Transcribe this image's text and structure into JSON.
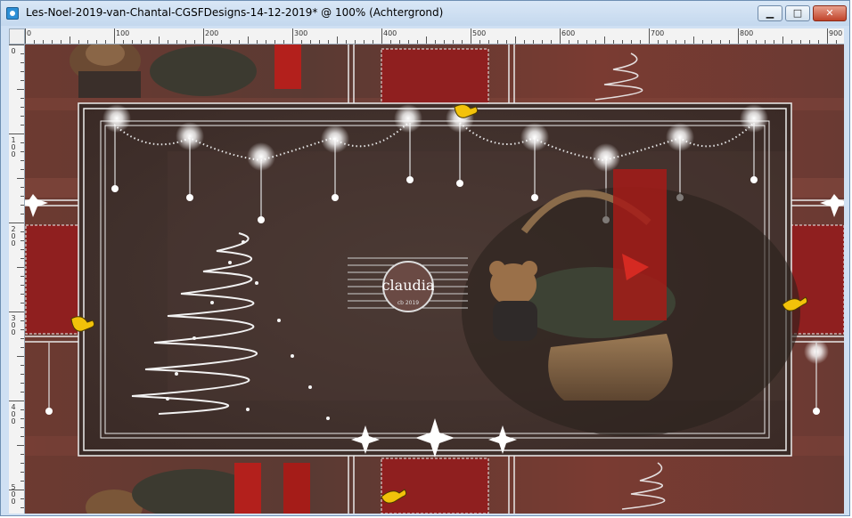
{
  "window": {
    "title": "Les-Noel-2019-van-Chantal-CGSFDesigns-14-12-2019* @ 100% (Achtergrond)",
    "app_icon": "paintshop-icon",
    "controls": {
      "minimize_icon": "minimize-icon",
      "maximize_icon": "maximize-icon",
      "close_icon": "close-icon"
    }
  },
  "ruler": {
    "horizontal": [
      "0",
      "100",
      "200",
      "300",
      "400",
      "500",
      "600",
      "700",
      "800",
      "900"
    ],
    "vertical": [
      "0",
      "100",
      "200",
      "300",
      "400",
      "500"
    ]
  },
  "canvas": {
    "watermark": "claudia",
    "watermark_sub": "cb 2019",
    "colors": {
      "background": "#4a302b",
      "red_panel": "#8f1f1f",
      "frame": "#e8e8e8",
      "pointer": "#f2c20a"
    }
  }
}
